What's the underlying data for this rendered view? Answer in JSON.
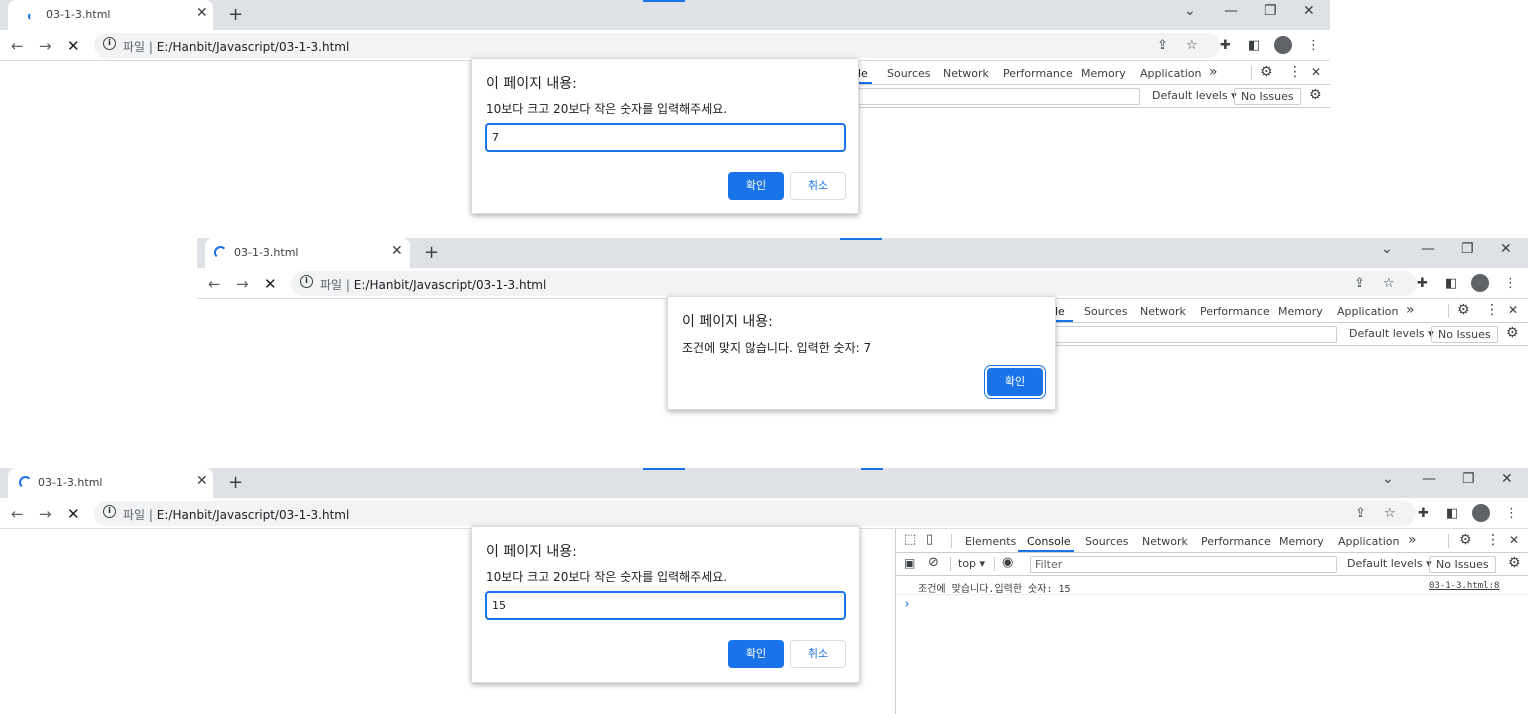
{
  "shared": {
    "tab_title": "03-1-3.html",
    "close_glyph": "✕",
    "new_tab_glyph": "+",
    "url_prefix": "파일",
    "url_sep": "|",
    "url": "E:/Hanbit/Javascript/03-1-3.html",
    "info_glyph": "i",
    "back_glyph": "←",
    "forward_glyph": "→",
    "stop_glyph": "✕",
    "dialog_title": "이 페이지 내용:",
    "ok_label": "확인",
    "cancel_label": "취소",
    "default_levels": "Default levels ▾",
    "no_issues": "No Issues",
    "more_glyph": "»",
    "kebab_glyph": "⋮",
    "gear_glyph": "⚙"
  },
  "devtools_tabs": [
    "Elements",
    "Console",
    "Sources",
    "Network",
    "Performance",
    "Memory",
    "Application"
  ],
  "screen1": {
    "dialog_message": "10보다 크고 20보다 작은 숫자를 입력해주세요.",
    "input_value": "7",
    "partial_tab": "le"
  },
  "screen2": {
    "dialog_message": "조건에 맞지 않습니다. 입력한 숫자: 7",
    "partial_tab": "le"
  },
  "screen3": {
    "dialog_message": "10보다 크고 20보다 작은 숫자를 입력해주세요.",
    "input_value": "15",
    "context": "top ▾",
    "filter_placeholder": "Filter",
    "console_log": "조건에 맞습니다.입력한 숫자: 15",
    "console_source": "03-1-3.html:8",
    "prompt_glyph": "›"
  },
  "colors": {
    "accent": "#1a73e8",
    "tabstrip": "#dee1e6",
    "omnibox": "#f1f3f4"
  }
}
